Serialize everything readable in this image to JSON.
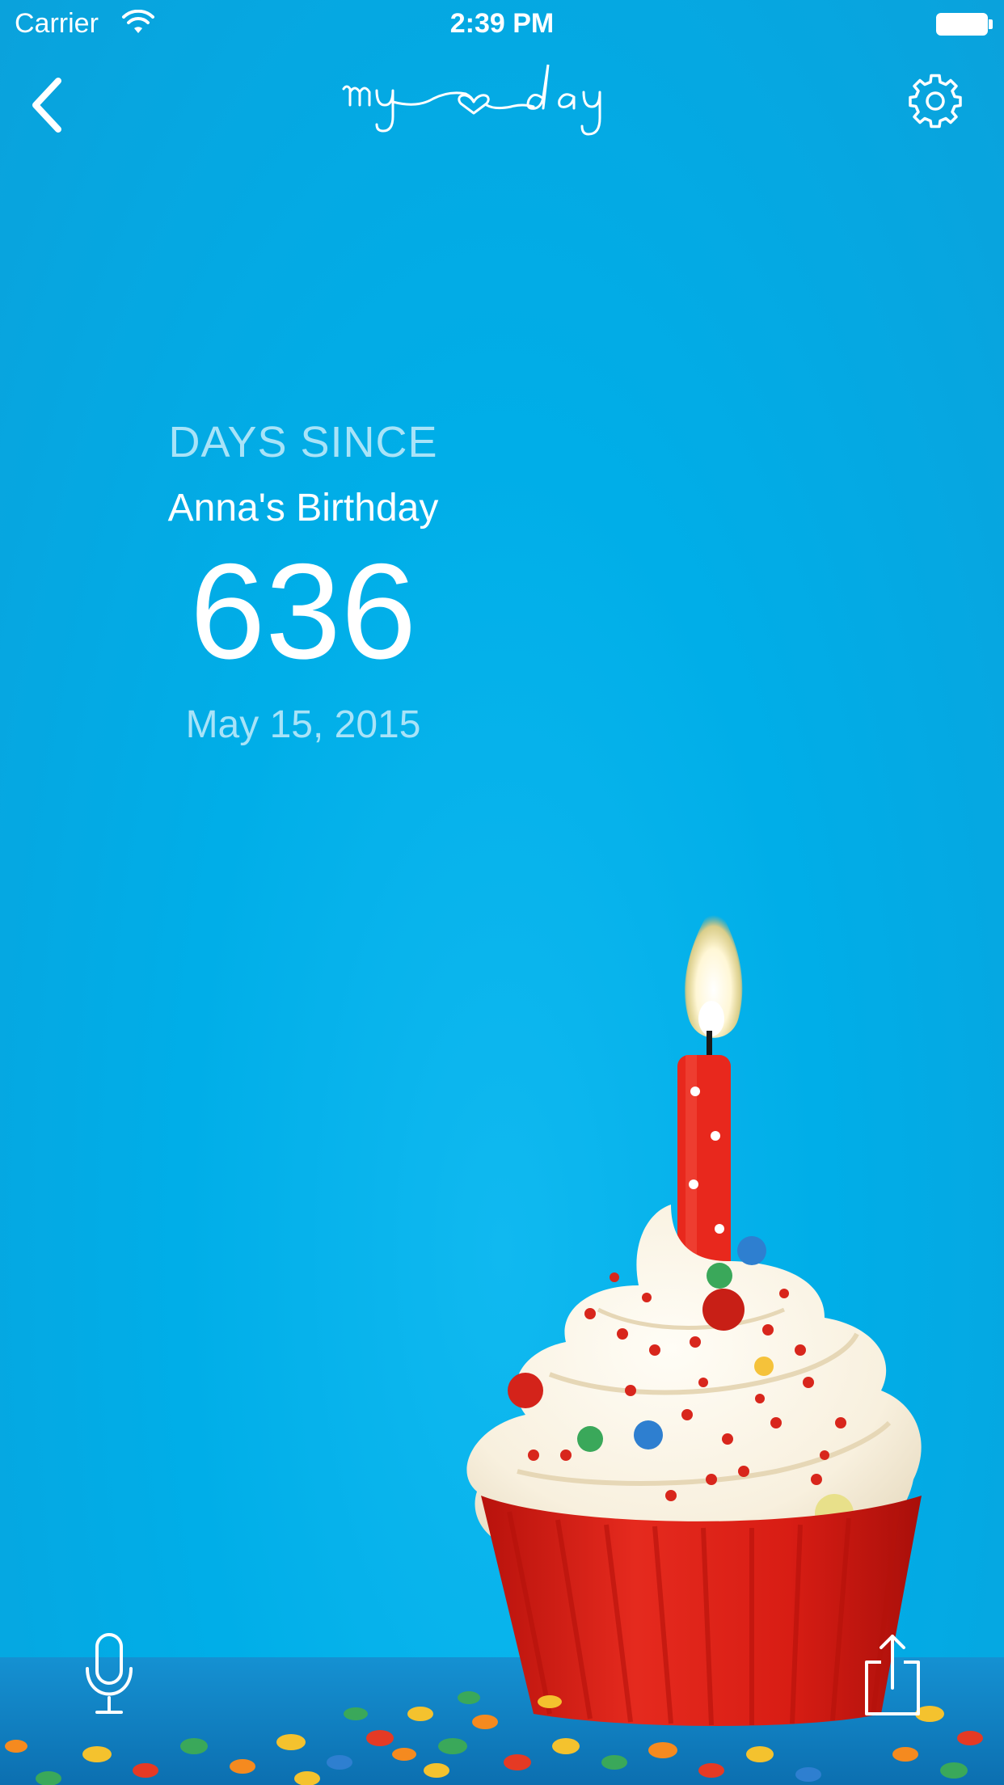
{
  "status_bar": {
    "carrier": "Carrier",
    "time": "2:39 PM",
    "wifi_icon": "wifi-icon",
    "battery_icon": "battery-icon"
  },
  "nav": {
    "back_icon": "chevron-left-icon",
    "logo_text": "my day",
    "settings_icon": "gear-icon"
  },
  "counter": {
    "label": "DAYS SINCE",
    "event_name": "Anna's Birthday",
    "count": "636",
    "date": "May 15, 2015"
  },
  "toolbar": {
    "mic_icon": "microphone-icon",
    "share_icon": "share-icon"
  },
  "colors": {
    "background": "#00aee8",
    "label_color": "#a8e3f8",
    "text_color": "#ffffff",
    "frosting": "#fdf8ec",
    "cup": "#e1251b",
    "candle": "#e8281d"
  }
}
